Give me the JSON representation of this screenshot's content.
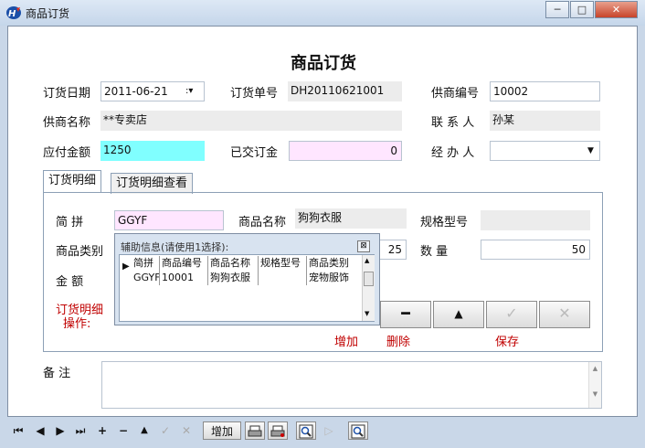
{
  "window": {
    "title": "商品订货",
    "min": "─",
    "max": "□",
    "close": "✕"
  },
  "form": {
    "title": "商品订货",
    "order_date": {
      "label": "订货日期",
      "value": "2011-06-21"
    },
    "order_no": {
      "label": "订货单号",
      "value": "DH20110621001"
    },
    "supplier_code": {
      "label": "供商编号",
      "value": "10002"
    },
    "supplier_name": {
      "label": "供商名称",
      "value": "**专卖店"
    },
    "contact": {
      "label": "联 系 人",
      "value": "孙某"
    },
    "amount_due": {
      "label": "应付金额",
      "value": "1250"
    },
    "deposit": {
      "label": "已交订金",
      "value": "0"
    },
    "handler": {
      "label": "经 办 人",
      "value": ""
    }
  },
  "tabs": [
    {
      "label": "订货明细"
    },
    {
      "label": "订货明细查看"
    }
  ],
  "detail": {
    "abbr": {
      "label": "简    拼",
      "value": "GGYF"
    },
    "product_name": {
      "label": "商品名称",
      "value": "狗狗衣服"
    },
    "spec": {
      "label": "规格型号",
      "value": ""
    },
    "category": {
      "label": "商品类别",
      "value": ""
    },
    "price_value": "25",
    "quantity": {
      "label": "数    量",
      "value": "50"
    },
    "amount": {
      "label": "金    额",
      "value": ""
    },
    "ops_label_1": "订货明细",
    "ops_label_2": "操作:",
    "ops": [
      {
        "label": "增加",
        "symbol": "━"
      },
      {
        "label": "删除",
        "symbol": "▲"
      },
      {
        "label": "保存",
        "symbol": "✓"
      },
      {
        "label": "",
        "symbol": "✕"
      }
    ]
  },
  "popup": {
    "title": "辅助信息(请使用1选择):",
    "columns": [
      "简拼",
      "商品编号",
      "商品名称",
      "规格型号",
      "商品类别"
    ],
    "rows": [
      [
        "GGYF",
        "10001",
        "狗狗衣服",
        "",
        "宠物服饰"
      ]
    ]
  },
  "remarks": {
    "label": "备    注",
    "value": ""
  },
  "toolbar": {
    "first": "⏮",
    "prev": "◀",
    "next": "▶",
    "last": "⏭",
    "add": "+",
    "remove": "−",
    "up": "▲",
    "check": "✓",
    "cancel": "✕",
    "add_button": "增加"
  }
}
